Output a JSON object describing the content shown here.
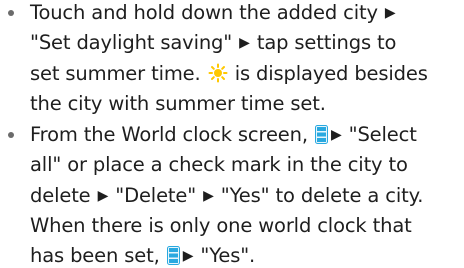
{
  "bullets": [
    {
      "lines": [
        {
          "seg1": "Touch and hold down the added city ",
          "arrow1": "▶"
        },
        {
          "seg1": "\"Set daylight saving\" ",
          "arrow1": "▶",
          "seg2": " tap settings to"
        },
        {
          "seg1": "set summer time. ",
          "icon": "sun-icon",
          "seg2": " is displayed besides"
        },
        {
          "seg1": "the city with summer time set."
        }
      ]
    },
    {
      "lines": [
        {
          "seg1": "From the World clock screen, ",
          "icon": "menu-key-icon",
          "arrow1": "▶",
          "seg2": " \"Select"
        },
        {
          "seg1": "all\" or place a check mark in the city to"
        },
        {
          "seg1": "delete ",
          "arrow1": "▶",
          "seg2": " \"Delete\" ",
          "arrow2": "▶",
          "seg3": " \"Yes\" to delete a city."
        },
        {
          "seg1": "When there is only one world clock that"
        },
        {
          "seg1": "has been set, ",
          "icon": "menu-key-icon",
          "arrow1": "▶",
          "seg2": " \"Yes\"."
        }
      ]
    }
  ],
  "colors": {
    "text": "#1e1e1e",
    "bullet": "#6b6b6b",
    "sun_icon": "#ffc800",
    "menu_icon": "#29a9e0"
  }
}
